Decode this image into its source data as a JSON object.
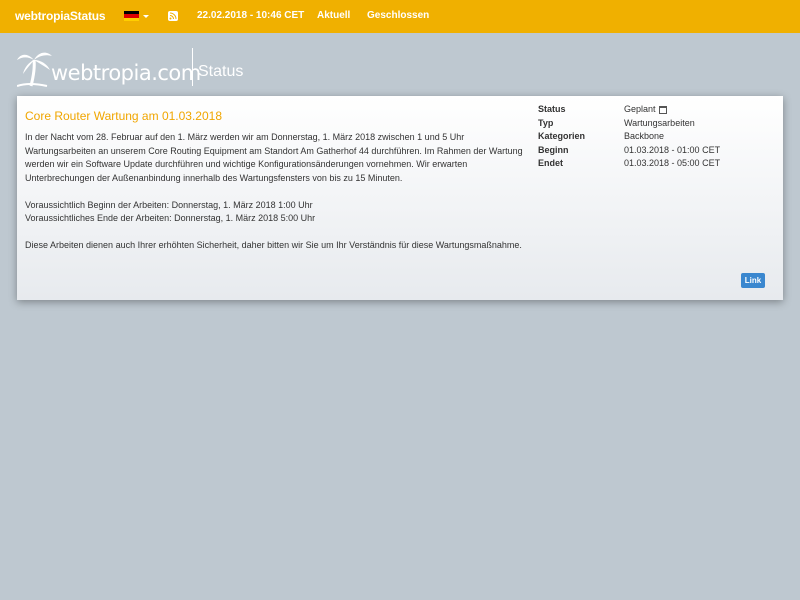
{
  "navbar": {
    "brand": "webtropiaStatus",
    "language_flag": "german-flag-icon",
    "datetime": "22.02.2018 - 10:46 CET",
    "link_current": "Aktuell",
    "link_closed": "Geschlossen",
    "colors": {
      "background": "#f0b000",
      "text": "#ffffff"
    }
  },
  "logo": {
    "text": "webtropia.com",
    "status": "Status"
  },
  "incident": {
    "title": "Core Router Wartung am 01.03.2018",
    "paragraphs": [
      "In der Nacht vom 28. Februar auf den 1. März werden wir am Donnerstag, 1. März 2018 zwischen 1 und 5 Uhr Wartungsarbeiten an unserem Core Routing Equipment am Standort Am Gatherhof 44 durchführen. Im Rahmen der Wartung werden wir ein Software Update durchführen und wichtige Konfigurationsänderungen vornehmen. Wir erwarten Unterbrechungen der Außenanbindung innerhalb des Wartungsfensters von bis zu 15 Minuten.",
      "Voraussichtlich Beginn der Arbeiten: Donnerstag, 1. März 2018 1:00 Uhr",
      "Voraussichtliches Ende der Arbeiten: Donnerstag, 1. März 2018 5:00 Uhr",
      "Diese Arbeiten dienen auch Ihrer erhöhten Sicherheit, daher bitten wir Sie um Ihr Verständnis für diese Wartungsmaßnahme."
    ],
    "meta": [
      {
        "key": "Status",
        "value": "Geplant"
      },
      {
        "key": "Typ",
        "value": "Wartungsarbeiten"
      },
      {
        "key": "Kategorien",
        "value": "Backbone"
      },
      {
        "key": "Beginn",
        "value": "01.03.2018 - 01:00 CET"
      },
      {
        "key": "Endet",
        "value": "01.03.2018 - 05:00 CET"
      }
    ],
    "link_label": "Link",
    "colors": {
      "title": "#f0a600",
      "link_button": "#3a87cf"
    }
  }
}
